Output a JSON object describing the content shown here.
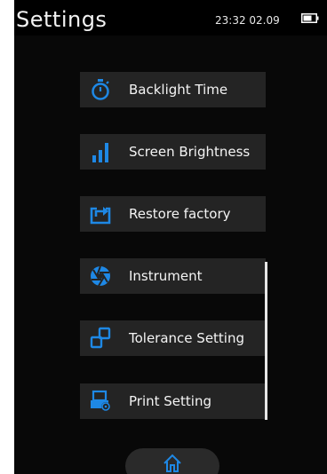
{
  "header": {
    "title": "Settings",
    "clock": "23:32 02.09",
    "battery_icon": "battery-icon"
  },
  "menu": {
    "items": [
      {
        "label": "Backlight Time",
        "icon": "stopwatch-icon"
      },
      {
        "label": "Screen Brightness",
        "icon": "signal-bars-icon"
      },
      {
        "label": "Restore factory",
        "icon": "restore-icon"
      },
      {
        "label": "Instrument",
        "icon": "aperture-icon"
      },
      {
        "label": "Tolerance Setting",
        "icon": "tolerance-icon"
      },
      {
        "label": "Print Setting",
        "icon": "printer-icon"
      }
    ]
  },
  "footer": {
    "home_icon": "home-icon"
  },
  "colors": {
    "accent": "#1e88e5",
    "background": "#080808",
    "item_background": "#242424",
    "text": "#f4f4f4"
  }
}
